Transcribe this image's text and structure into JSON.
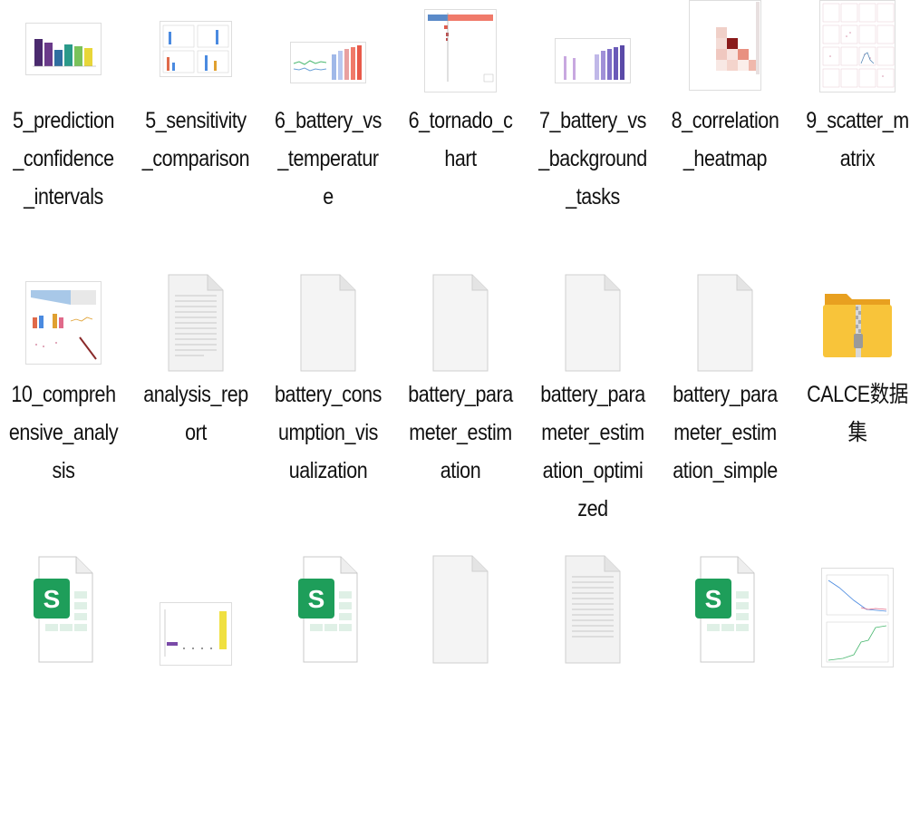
{
  "files": [
    {
      "name": "5_prediction_confidence_intervals",
      "type": "image",
      "preview": "bar-chart-thumbnail"
    },
    {
      "name": "5_sensitivity_comparison",
      "type": "image",
      "preview": "multi-panel-chart-thumbnail"
    },
    {
      "name": "6_battery_vs_temperature",
      "type": "image",
      "preview": "line-bar-chart-thumbnail"
    },
    {
      "name": "6_tornado_chart",
      "type": "image",
      "preview": "tornado-chart-thumbnail"
    },
    {
      "name": "7_battery_vs_background_tasks",
      "type": "image",
      "preview": "bar-chart-thumbnail"
    },
    {
      "name": "8_correlation_heatmap",
      "type": "image",
      "preview": "heatmap-thumbnail"
    },
    {
      "name": "9_scatter_matrix",
      "type": "image",
      "preview": "scatter-matrix-thumbnail"
    },
    {
      "name": "10_comprehensive_analysis",
      "type": "image",
      "preview": "dashboard-chart-thumbnail"
    },
    {
      "name": "analysis_report",
      "type": "text-document",
      "preview": "text-document-icon"
    },
    {
      "name": "battery_consumption_visualization",
      "type": "blank-document",
      "preview": "blank-file-icon"
    },
    {
      "name": "battery_parameter_estimation",
      "type": "blank-document",
      "preview": "blank-file-icon"
    },
    {
      "name": "battery_parameter_estimation_optimized",
      "type": "blank-document",
      "preview": "blank-file-icon"
    },
    {
      "name": "battery_parameter_estimation_simple",
      "type": "blank-document",
      "preview": "blank-file-icon"
    },
    {
      "name": "CALCE数据集",
      "type": "zip-folder",
      "preview": "zip-folder-icon"
    },
    {
      "name": "",
      "type": "spreadsheet",
      "preview": "spreadsheet-icon"
    },
    {
      "name": "",
      "type": "image",
      "preview": "bar-chart-thumbnail"
    },
    {
      "name": "",
      "type": "spreadsheet",
      "preview": "spreadsheet-icon"
    },
    {
      "name": "",
      "type": "blank-document",
      "preview": "blank-file-icon"
    },
    {
      "name": "",
      "type": "text-document",
      "preview": "text-document-icon"
    },
    {
      "name": "",
      "type": "spreadsheet",
      "preview": "spreadsheet-icon"
    },
    {
      "name": "",
      "type": "image",
      "preview": "line-chart-thumbnail"
    }
  ],
  "colors": {
    "spreadsheet_green": "#1e9e5a",
    "folder_yellow": "#f5b82e",
    "page_border": "#cfcfcf"
  }
}
